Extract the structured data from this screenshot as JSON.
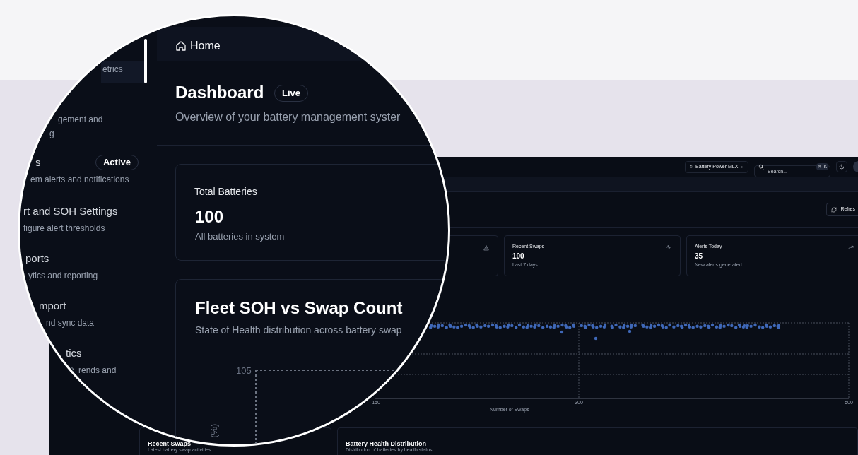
{
  "screenshot": {
    "top_bar": {
      "workspace": "Battery Power MLX",
      "search": {
        "placeholder": "Search...",
        "shortcut": "⌘ K"
      }
    },
    "refresh_button": "Refres",
    "stat_cards": [
      {
        "title": "Recent Swaps",
        "value": "100",
        "caption": "Last 7 days",
        "kind": "activity"
      },
      {
        "title": "Alerts Today",
        "value": "35",
        "caption": "New alerts generated",
        "kind": "trend"
      }
    ],
    "chart": {
      "x_ticks": [
        "150",
        "300",
        "500"
      ],
      "xlabel": "Number of Swaps"
    },
    "bottom_cards": [
      {
        "title": "Recent Swaps",
        "subtitle": "Latest battery swap activities"
      },
      {
        "title": "Battery Health Distribution",
        "subtitle": "Distribution of batteries by health status"
      }
    ]
  },
  "magnifier": {
    "sidebar_items": [
      {
        "lines": [
          "etrics"
        ],
        "selected": true
      },
      {
        "lines": [
          "gement and",
          "g"
        ],
        "selected": false
      },
      {
        "title": "s",
        "badge": "Active",
        "lines": [
          "em alerts and notifications"
        ],
        "selected": false
      },
      {
        "title": "rt and SOH Settings",
        "lines": [
          "figure alert thresholds"
        ],
        "selected": false
      },
      {
        "title": "ports",
        "lines": [
          "ytics and reporting"
        ],
        "selected": false
      },
      {
        "title": "mport",
        "lines": [
          "nd sync data"
        ],
        "selected": false
      },
      {
        "title": "tics",
        "lines": [
          "rends and"
        ],
        "selected": false
      }
    ],
    "breadcrumb": "Home",
    "title": "Dashboard",
    "badge": "Live",
    "subtitle": "Overview of your battery management syster",
    "stat_card": {
      "title": "Total Batteries",
      "value": "100",
      "caption": "All batteries in system"
    },
    "chart": {
      "title": "Fleet SOH vs Swap Count",
      "subtitle": "State of Health distribution across battery swap",
      "y_tick": "105",
      "ylabel": "(%)"
    }
  }
}
